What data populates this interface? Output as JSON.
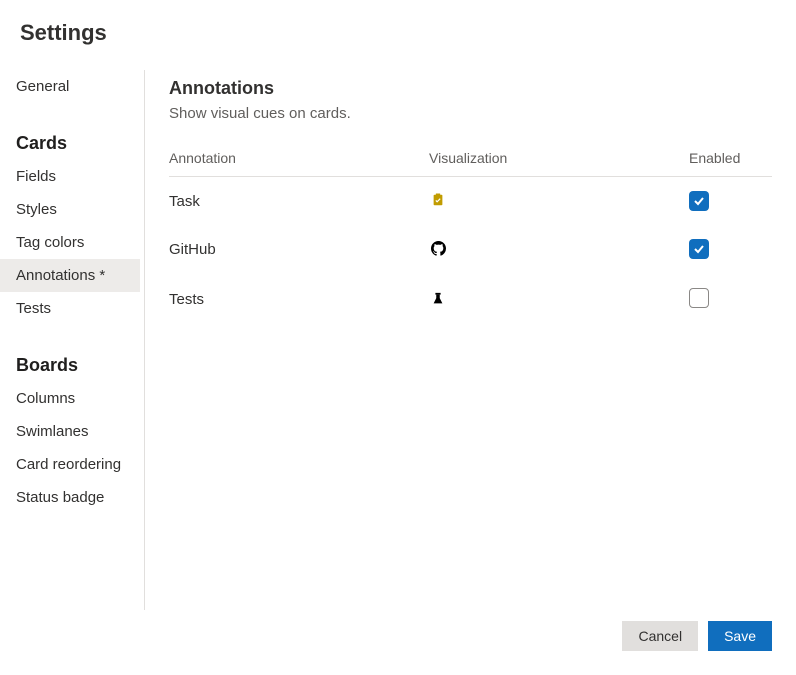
{
  "page_title": "Settings",
  "sidebar": {
    "top_items": [
      {
        "label": "General",
        "active": false
      }
    ],
    "sections": [
      {
        "title": "Cards",
        "items": [
          {
            "label": "Fields",
            "active": false
          },
          {
            "label": "Styles",
            "active": false
          },
          {
            "label": "Tag colors",
            "active": false
          },
          {
            "label": "Annotations *",
            "active": true
          },
          {
            "label": "Tests",
            "active": false
          }
        ]
      },
      {
        "title": "Boards",
        "items": [
          {
            "label": "Columns",
            "active": false
          },
          {
            "label": "Swimlanes",
            "active": false
          },
          {
            "label": "Card reordering",
            "active": false
          },
          {
            "label": "Status badge",
            "active": false
          }
        ]
      }
    ]
  },
  "main": {
    "heading": "Annotations",
    "subheading": "Show visual cues on cards.",
    "columns": {
      "annotation": "Annotation",
      "visualization": "Visualization",
      "enabled": "Enabled"
    },
    "rows": [
      {
        "annotation": "Task",
        "icon": "task",
        "enabled": true
      },
      {
        "annotation": "GitHub",
        "icon": "github",
        "enabled": true
      },
      {
        "annotation": "Tests",
        "icon": "tests",
        "enabled": false
      }
    ]
  },
  "footer": {
    "cancel_label": "Cancel",
    "save_label": "Save"
  },
  "colors": {
    "primary": "#106ebe",
    "task_icon": "#c19c00"
  }
}
